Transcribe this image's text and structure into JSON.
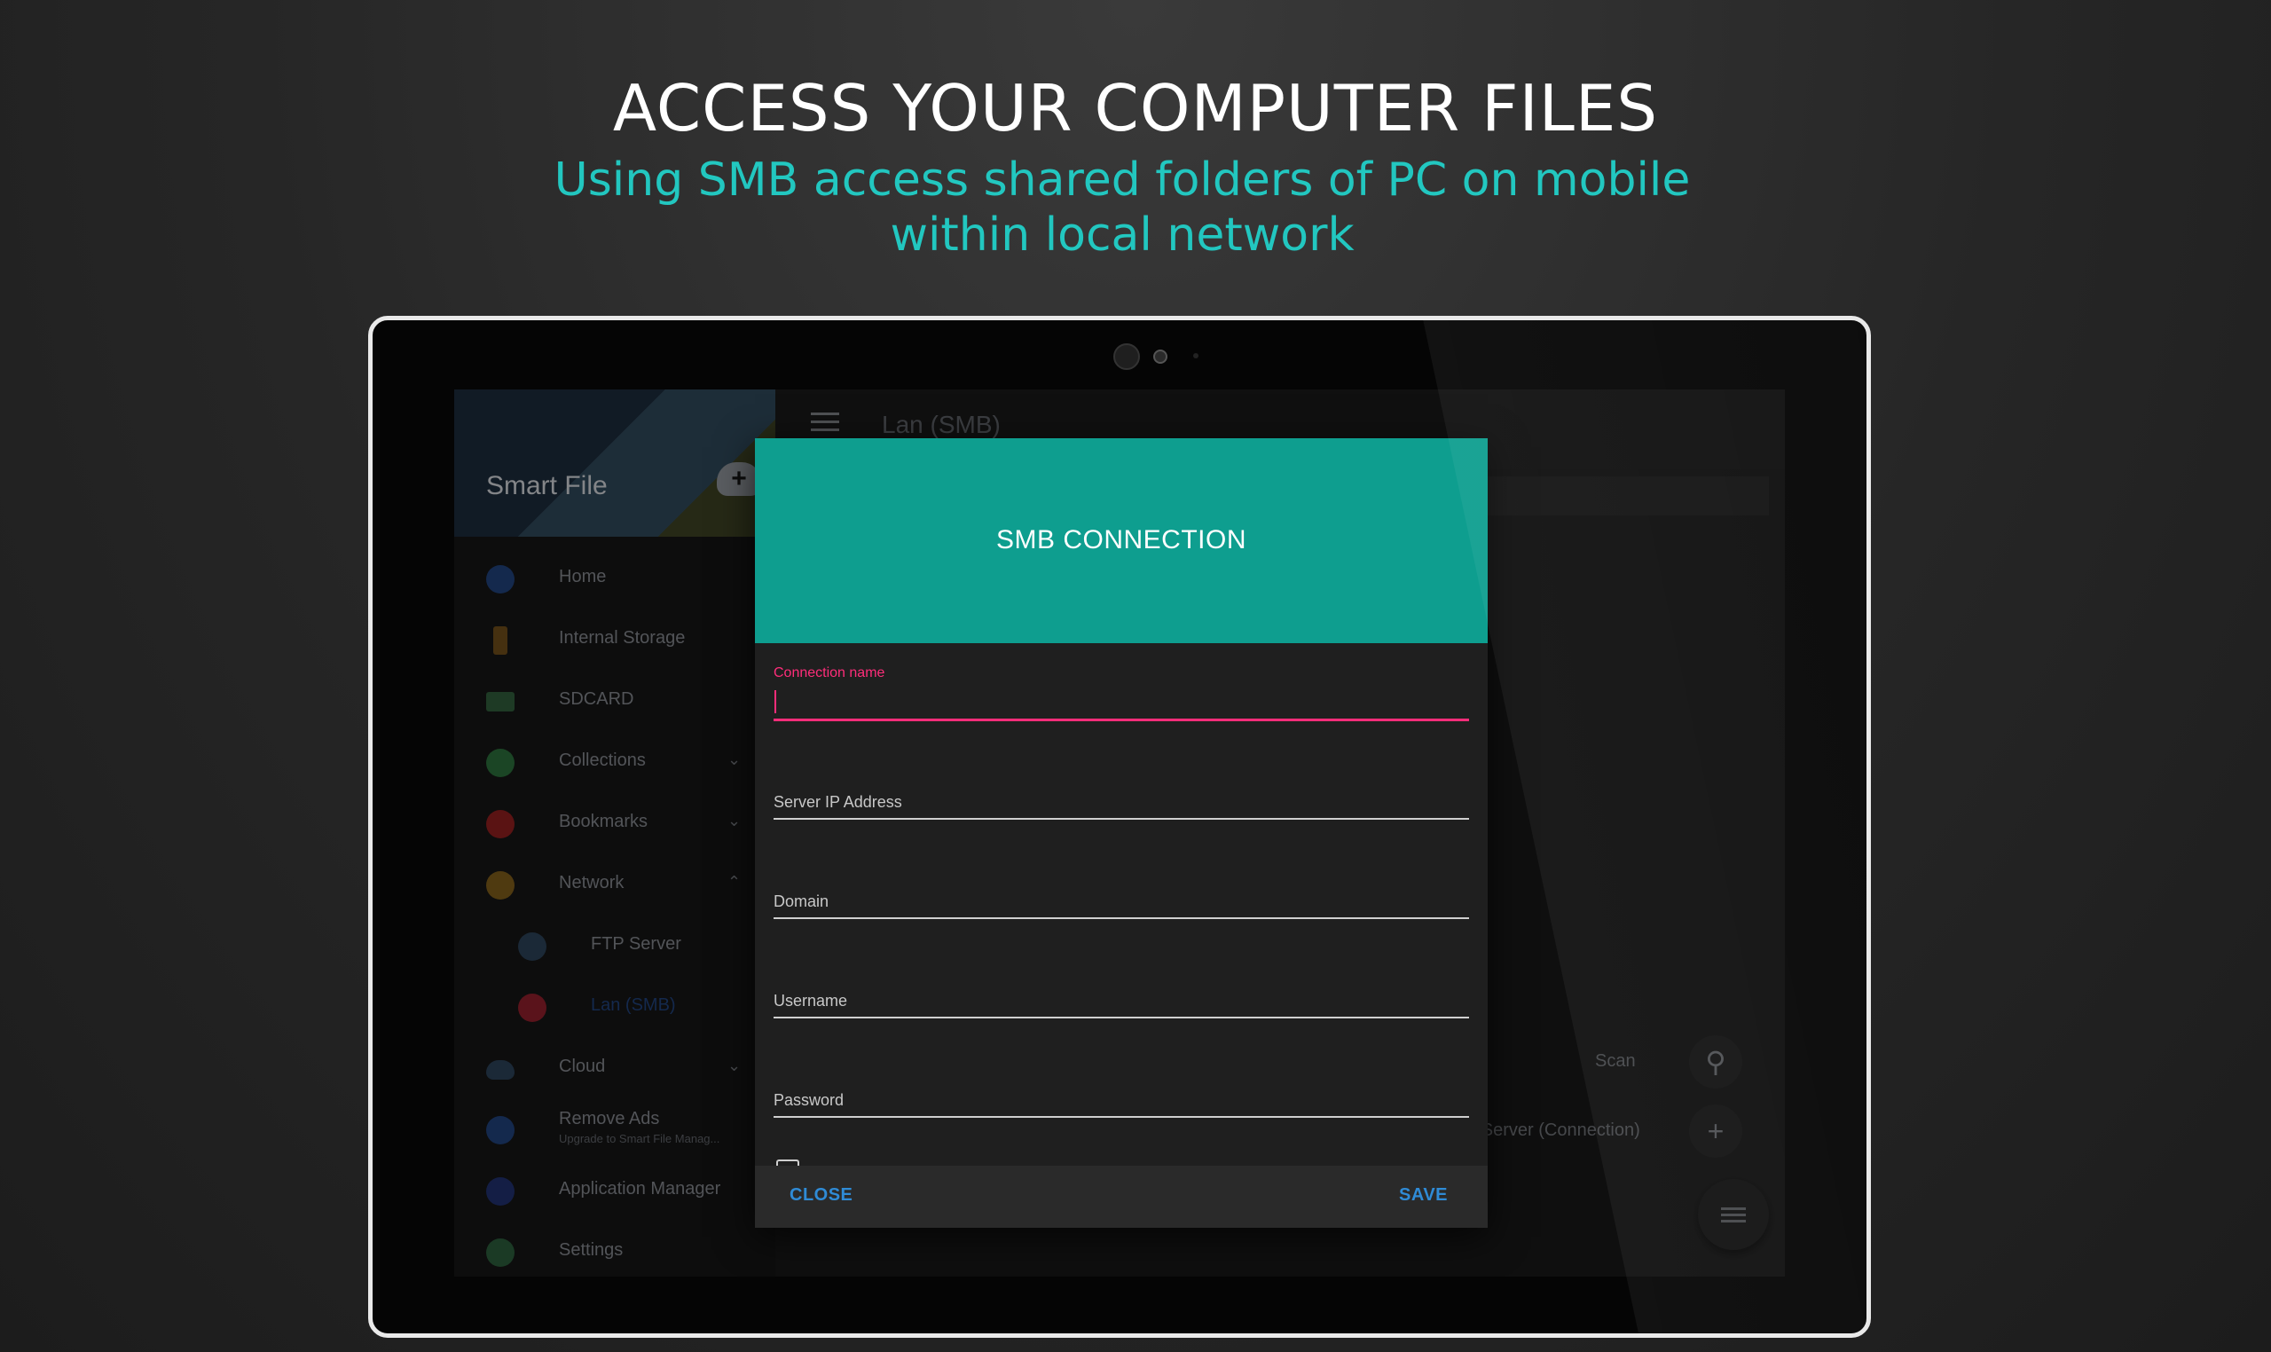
{
  "headline": "ACCESS YOUR COMPUTER FILES",
  "subline": "Using SMB access shared folders of PC on mobile within local network",
  "drawer": {
    "app_title": "Smart File",
    "items": [
      {
        "label": "Home",
        "icon": "home-icon",
        "color": "#1f3f77"
      },
      {
        "label": "Internal Storage",
        "icon": "storage-icon",
        "color": "#6b4a1a"
      },
      {
        "label": "SDCARD",
        "icon": "sdcard-icon",
        "color": "#2f5a3a"
      },
      {
        "label": "Collections",
        "icon": "collections-icon",
        "color": "#2a6b3a"
      },
      {
        "label": "Bookmarks",
        "icon": "bookmark-icon",
        "color": "#8a1e1e"
      },
      {
        "label": "Network",
        "icon": "network-icon",
        "color": "#7a5a1a"
      },
      {
        "label": "FTP Server",
        "icon": "globe-icon",
        "color": "#2a3f55"
      },
      {
        "label": "Lan (SMB)",
        "icon": "smb-icon",
        "color": "#8a1e2a"
      },
      {
        "label": "Cloud",
        "icon": "cloud-icon",
        "color": "#2a3f55"
      },
      {
        "label": "Remove Ads",
        "sub": "Upgrade to Smart File Manag...",
        "icon": "crown-icon",
        "color": "#1f3f77"
      },
      {
        "label": "Application Manager",
        "icon": "app-manager-icon",
        "color": "#1f2f6a"
      },
      {
        "label": "Settings",
        "icon": "settings-icon",
        "color": "#2a5a3a"
      }
    ]
  },
  "main": {
    "toolbar_title": "Lan (SMB)",
    "scan_label": "Scan",
    "add_server_label": "dd Server (Connection)"
  },
  "dialog": {
    "title": "SMB CONNECTION",
    "fields": {
      "connection_name": {
        "label": "Connection name",
        "value": ""
      },
      "server_ip": {
        "label": "Server IP Address",
        "value": ""
      },
      "domain": {
        "label": "Domain",
        "value": ""
      },
      "username": {
        "label": "Username",
        "value": ""
      },
      "password": {
        "label": "Password",
        "value": ""
      }
    },
    "close_label": "CLOSE",
    "save_label": "SAVE"
  },
  "colors": {
    "accent_teal": "#0e9e8f",
    "focus_pink": "#ff2d7a",
    "button_blue": "#2f8bd6",
    "subline": "#22c7c0"
  }
}
